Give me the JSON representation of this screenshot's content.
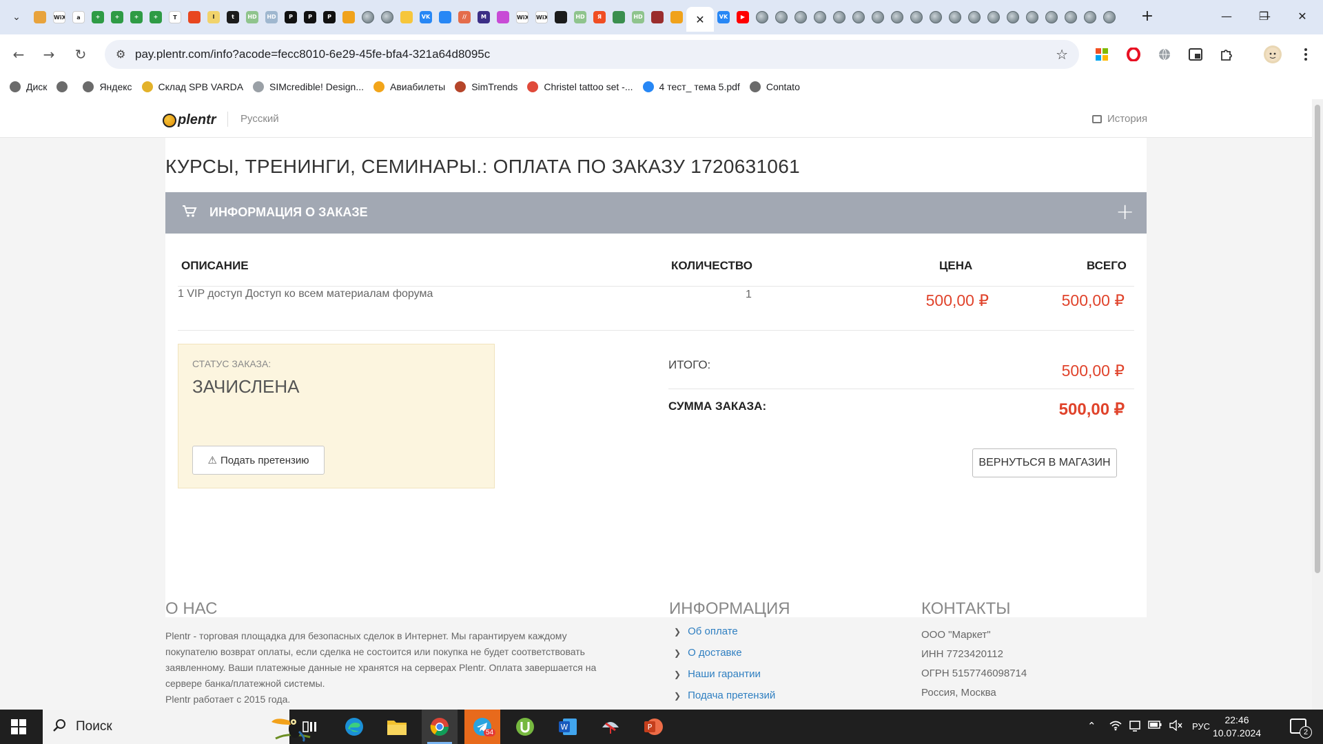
{
  "browser": {
    "active_tab_close": "✕",
    "new_tab": "+",
    "window_buttons": {
      "minimize": "—",
      "restore": "❐",
      "close": "✕"
    },
    "url": "pay.plentr.com/info?acode=fecc8010-6e29-45fe-bfa4-321a64d8095c",
    "pinned_tabs": [
      {
        "icon": "gallery-icon",
        "color": "#e8a33c",
        "text": ""
      },
      {
        "icon": "wix-icon",
        "color": "#ffffff",
        "text": "WiX"
      },
      {
        "icon": "a-icon",
        "color": "#ffffff",
        "text": "a"
      },
      {
        "icon": "green-plus-icon",
        "color": "#2e9b45",
        "text": "+"
      },
      {
        "icon": "green-plus-icon",
        "color": "#2e9b45",
        "text": "+"
      },
      {
        "icon": "green-plus-icon",
        "color": "#2e9b45",
        "text": "+"
      },
      {
        "icon": "green-plus-icon",
        "color": "#2e9b45",
        "text": "+"
      },
      {
        "icon": "t-circle-icon",
        "color": "#ffffff",
        "text": "T"
      },
      {
        "icon": "flame-icon",
        "color": "#e8461f",
        "text": ""
      },
      {
        "icon": "text-cursor-icon",
        "color": "#f1d36b",
        "text": "I"
      },
      {
        "icon": "tumblr-icon",
        "color": "#1b1b1b",
        "text": "t"
      },
      {
        "icon": "hd-icon",
        "color": "#8fc48d",
        "text": "HD"
      },
      {
        "icon": "hd-icon",
        "color": "#9fb7cf",
        "text": "HD"
      },
      {
        "icon": "notion-icon",
        "color": "#111111",
        "text": "P"
      },
      {
        "icon": "notion-icon",
        "color": "#111111",
        "text": "P"
      },
      {
        "icon": "notion-icon",
        "color": "#111111",
        "text": "P"
      },
      {
        "icon": "mail-icon",
        "color": "#f0a21b",
        "text": ""
      },
      {
        "icon": "globe-icon",
        "color": "#8a969c",
        "text": ""
      },
      {
        "icon": "globe-icon",
        "color": "#8a969c",
        "text": ""
      },
      {
        "icon": "note-icon",
        "color": "#f6c63b",
        "text": ""
      },
      {
        "icon": "vk-icon",
        "color": "#2787f5",
        "text": "VK"
      },
      {
        "icon": "chat-icon",
        "color": "#2787f5",
        "text": ""
      },
      {
        "icon": "slash-icon",
        "color": "#e46c4b",
        "text": "//"
      },
      {
        "icon": "m-icon",
        "color": "#3b2e86",
        "text": "M"
      },
      {
        "icon": "colorful-icon",
        "color": "#c84bd6",
        "text": ""
      },
      {
        "icon": "wix-icon",
        "color": "#ffffff",
        "text": "WiX"
      },
      {
        "icon": "wix-icon",
        "color": "#ffffff",
        "text": "WiX"
      },
      {
        "icon": "dark-site-icon",
        "color": "#1b1b1b",
        "text": ""
      },
      {
        "icon": "hd-icon",
        "color": "#8fc48d",
        "text": "HD"
      },
      {
        "icon": "yandex-icon",
        "color": "#f04e23",
        "text": "Я"
      },
      {
        "icon": "book-icon",
        "color": "#3a8f4e",
        "text": ""
      },
      {
        "icon": "hd-icon",
        "color": "#8fc48d",
        "text": "HD"
      },
      {
        "icon": "feather-icon",
        "color": "#9a2d2d",
        "text": ""
      },
      {
        "icon": "mail-icon",
        "color": "#f0a21b",
        "text": ""
      }
    ],
    "after_tabs": [
      {
        "icon": "vk-icon",
        "color": "#2787f5",
        "text": "VK"
      },
      {
        "icon": "youtube-icon",
        "color": "#ff0000",
        "text": "▶"
      },
      {
        "icon": "globe-icon",
        "color": "#8a969c",
        "text": ""
      },
      {
        "icon": "globe-icon",
        "color": "#8a969c",
        "text": ""
      },
      {
        "icon": "globe-icon",
        "color": "#8a969c",
        "text": ""
      },
      {
        "icon": "globe-icon",
        "color": "#8a969c",
        "text": ""
      },
      {
        "icon": "globe-icon",
        "color": "#8a969c",
        "text": ""
      },
      {
        "icon": "globe-icon",
        "color": "#8a969c",
        "text": ""
      },
      {
        "icon": "globe-icon",
        "color": "#8a969c",
        "text": ""
      },
      {
        "icon": "globe-icon",
        "color": "#8a969c",
        "text": ""
      },
      {
        "icon": "globe-icon",
        "color": "#8a969c",
        "text": ""
      },
      {
        "icon": "globe-icon",
        "color": "#8a969c",
        "text": ""
      },
      {
        "icon": "globe-icon",
        "color": "#8a969c",
        "text": ""
      },
      {
        "icon": "globe-icon",
        "color": "#8a969c",
        "text": ""
      },
      {
        "icon": "globe-icon",
        "color": "#8a969c",
        "text": ""
      },
      {
        "icon": "globe-icon",
        "color": "#8a969c",
        "text": ""
      },
      {
        "icon": "globe-icon",
        "color": "#8a969c",
        "text": ""
      },
      {
        "icon": "globe-icon",
        "color": "#8a969c",
        "text": ""
      },
      {
        "icon": "globe-icon",
        "color": "#8a969c",
        "text": ""
      },
      {
        "icon": "globe-icon",
        "color": "#8a969c",
        "text": ""
      },
      {
        "icon": "globe-icon",
        "color": "#8a969c",
        "text": ""
      }
    ]
  },
  "bookmarks": [
    {
      "label": "Диск",
      "icon": "globe-icon",
      "color": "#6b6b6b"
    },
    {
      "label": "",
      "icon": "globe-icon",
      "color": "#6b6b6b"
    },
    {
      "label": "Яндекс",
      "icon": "globe-icon",
      "color": "#6b6b6b"
    },
    {
      "label": "Склад SPB VARDA",
      "icon": "varda-icon",
      "color": "#e3b22a"
    },
    {
      "label": "SIMcredible! Design...",
      "icon": "sim-icon",
      "color": "#9aa0a6"
    },
    {
      "label": "Авиабилеты",
      "icon": "plane-icon",
      "color": "#f2a51a"
    },
    {
      "label": "SimTrends",
      "icon": "simtrends-icon",
      "color": "#b5452a"
    },
    {
      "label": "Christel tattoo set -...",
      "icon": "yandex-market-icon",
      "color": "#e04a3a"
    },
    {
      "label": "4 тест_ тема 5.pdf",
      "icon": "vk-icon",
      "color": "#2787f5"
    },
    {
      "label": "Contato",
      "icon": "globe-icon",
      "color": "#6b6b6b"
    }
  ],
  "site": {
    "logo_text": "plentr",
    "language": "Русский",
    "history": "История"
  },
  "order": {
    "title": "КУРСЫ, ТРЕНИНГИ, СЕМИНАРЫ.: ОПЛАТА ПО ЗАКАЗУ 1720631061",
    "section_title": "ИНФОРМАЦИЯ О ЗАКАЗЕ",
    "columns": {
      "description": "ОПИСАНИЕ",
      "quantity": "КОЛИЧЕСТВО",
      "price": "ЦЕНА",
      "total": "ВСЕГО"
    },
    "item": {
      "description": "1 VIP доступ Доступ ко всем материалам форума",
      "quantity": "1",
      "price": "500,00 ₽",
      "total": "500,00 ₽"
    },
    "status_label": "СТАТУС ЗАКАЗА:",
    "status_value": "ЗАЧИСЛЕНА",
    "claim_button": "Подать претензию",
    "subtotal_label": "ИТОГО:",
    "subtotal_value": "500,00 ₽",
    "sum_label": "СУММА ЗАКАЗА:",
    "sum_value": "500,00 ₽",
    "back_button": "ВЕРНУТЬСЯ В МАГАЗИН",
    "accent_color": "#e0432b"
  },
  "footer": {
    "about_title": "О НАС",
    "about_text": "Plentr - торговая площадка для безопасных сделок в Интернет. Мы гарантируем каждому покупателю возврат оплаты, если сделка не состоится или покупка не будет соответствовать заявленному. Ваши платежные данные не хранятся на серверах Plentr. Оплата завершается на сервере банка/платежной системы.",
    "about_since": "Plentr работает с 2015 года.",
    "info_title": "ИНФОРМАЦИЯ",
    "info_links": [
      "Об оплате",
      "О доставке",
      "Наши гарантии",
      "Подача претензий"
    ],
    "contacts_title": "КОНТАКТЫ",
    "contacts": [
      "ООО \"Маркет\"",
      "ИНН 7723420112",
      "ОГРН 5157746098714",
      "Россия, Москва"
    ]
  },
  "taskbar": {
    "search_placeholder": "Поиск",
    "telegram_badge": "54",
    "language": "РУС",
    "time": "22:46",
    "date": "10.07.2024",
    "notifications": "2"
  }
}
